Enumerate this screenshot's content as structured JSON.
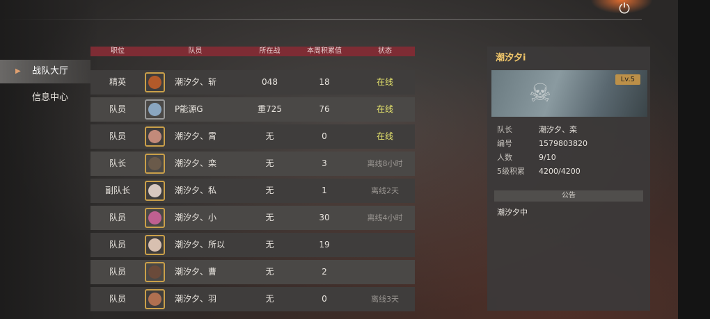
{
  "header": {
    "power_icon": "power-icon"
  },
  "menu": {
    "items": [
      {
        "label": "战队大厅",
        "active": true
      },
      {
        "label": "信息中心",
        "active": false
      }
    ]
  },
  "table": {
    "headers": {
      "role": "职位",
      "member": "队员",
      "location": "所在战",
      "week": "本周积累值",
      "status": "状态"
    },
    "rows": [
      {
        "role": "精英",
        "name": "潮汐夕、斩",
        "location": "048",
        "week": "18",
        "status": "在线",
        "online": true
      },
      {
        "role": "队员",
        "name": "P能源G",
        "location": "重725",
        "week": "76",
        "status": "在线",
        "online": true
      },
      {
        "role": "队员",
        "name": "潮汐夕、霄",
        "location": "无",
        "week": "0",
        "status": "在线",
        "online": true
      },
      {
        "role": "队长",
        "name": "潮汐夕、栾",
        "location": "无",
        "week": "3",
        "status": "离线8小时",
        "online": false
      },
      {
        "role": "副队长",
        "name": "潮汐夕、私",
        "location": "无",
        "week": "1",
        "status": "离线2天",
        "online": false
      },
      {
        "role": "队员",
        "name": "潮汐夕、小",
        "location": "无",
        "week": "30",
        "status": "离线4小时",
        "online": false
      },
      {
        "role": "队员",
        "name": "潮汐夕、所以",
        "location": "无",
        "week": "19",
        "status": "",
        "online": false
      },
      {
        "role": "队员",
        "name": "潮汐夕、曹",
        "location": "无",
        "week": "2",
        "status": "",
        "online": false
      },
      {
        "role": "队员",
        "name": "潮汐夕、羽",
        "location": "无",
        "week": "0",
        "status": "离线3天",
        "online": false
      }
    ]
  },
  "panel": {
    "title": "潮汐夕i",
    "level": "Lv.5",
    "info": [
      {
        "key": "队长",
        "value": "潮汐夕、栾"
      },
      {
        "key": "编号",
        "value": "1579803820"
      },
      {
        "key": "人数",
        "value": "9/10"
      },
      {
        "key": "5级积累",
        "value": "4200/4200"
      }
    ],
    "announce_title": "公告",
    "announce_text": "潮汐夕中"
  }
}
